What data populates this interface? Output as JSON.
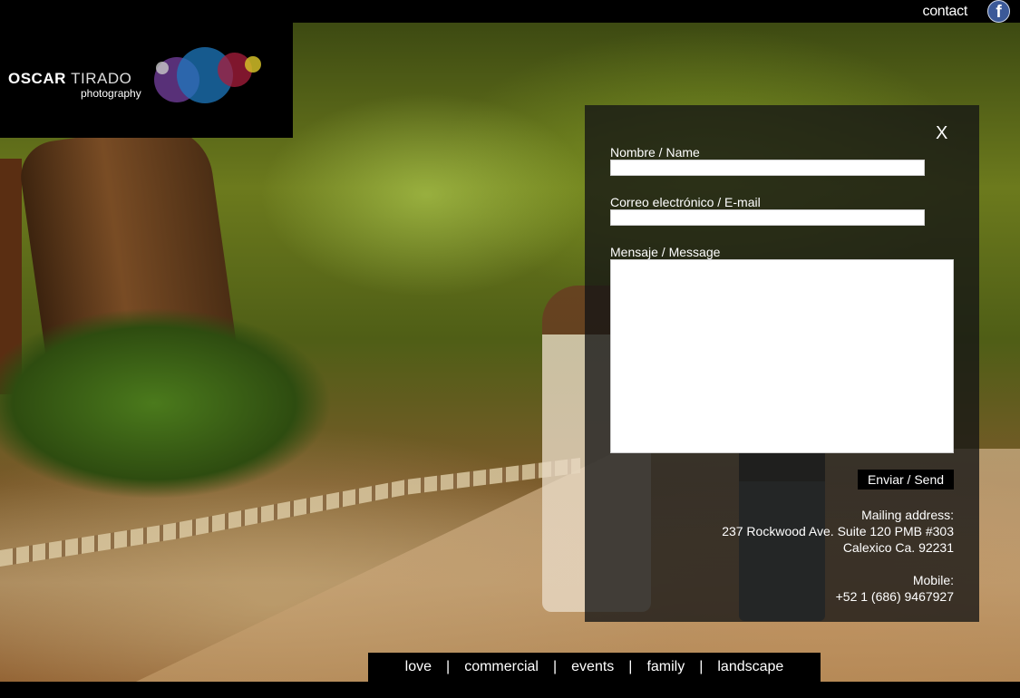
{
  "header": {
    "contact_label": "contact",
    "facebook_glyph": "f",
    "facebook_icon": "facebook-icon"
  },
  "logo": {
    "name_first": "OSCAR",
    "name_last": "TIRADO",
    "subtitle": "photography"
  },
  "contact_form": {
    "close_label": "X",
    "name_label": "Nombre / Name",
    "name_value": "",
    "email_label": "Correo electrónico / E-mail",
    "email_value": "",
    "message_label": "Mensaje / Message",
    "message_value": "",
    "send_label": "Enviar / Send"
  },
  "contact_info": {
    "mailing_label": "Mailing address:",
    "address_line1": "237 Rockwood Ave. Suite 120 PMB #303",
    "address_line2": "Calexico Ca. 92231",
    "mobile_label": "Mobile:",
    "mobile_value": "+52 1 (686) 9467927"
  },
  "nav": {
    "separator": "|",
    "items": [
      "love",
      "commercial",
      "events",
      "family",
      "landscape"
    ]
  },
  "colors": {
    "facebook": "#3b5998",
    "panel_bg": "#141414",
    "bar_bg": "#000000"
  }
}
